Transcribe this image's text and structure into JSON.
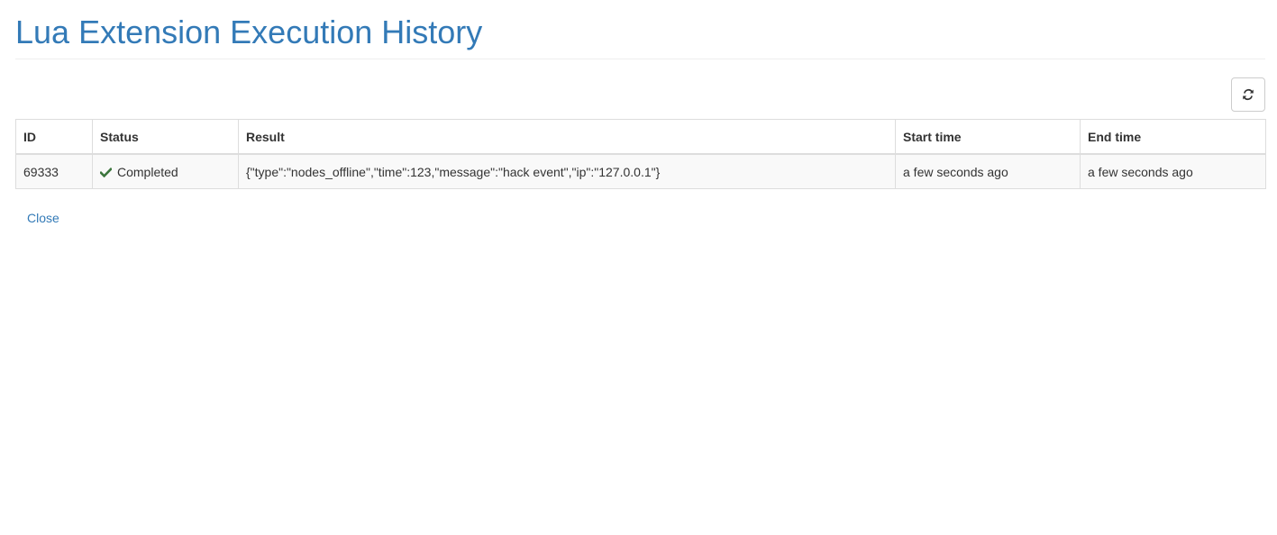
{
  "page": {
    "title": "Lua Extension Execution History"
  },
  "toolbar": {
    "refresh_icon": "refresh-icon"
  },
  "table": {
    "columns": [
      "ID",
      "Status",
      "Result",
      "Start time",
      "End time"
    ],
    "rows": [
      {
        "id": "69333",
        "status": "Completed",
        "status_icon": "check-icon",
        "result": "{\"type\":\"nodes_offline\",\"time\":123,\"message\":\"hack event\",\"ip\":\"127.0.0.1\"}",
        "start_time": "a few seconds ago",
        "end_time": "a few seconds ago"
      }
    ]
  },
  "footer": {
    "close_label": "Close"
  },
  "colors": {
    "title": "#337ab7",
    "link": "#337ab7",
    "success": "#3c763d",
    "border": "#dddddd",
    "row_stripe": "#f9f9f9"
  }
}
